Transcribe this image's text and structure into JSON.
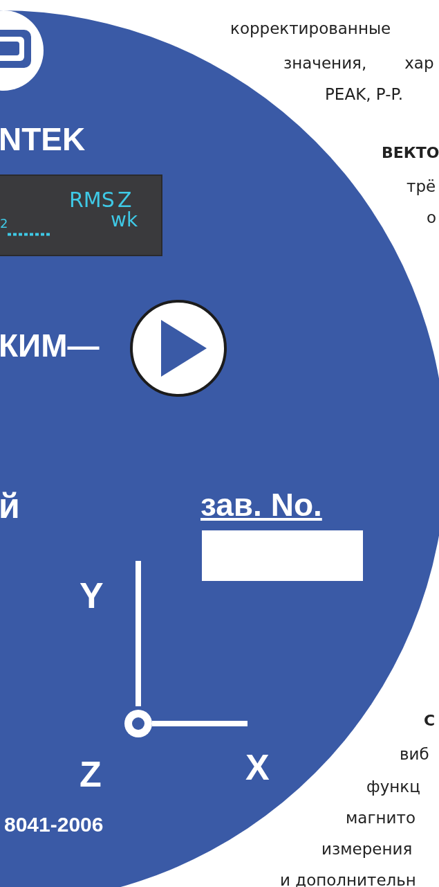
{
  "device_face": {
    "brand": "NTEK",
    "display": {
      "sub_digit": "2",
      "mode": "RMS",
      "axis": "Z",
      "weighting": "wk"
    },
    "mode_label": "КИМ—",
    "left_fragment": "й",
    "serial_label": "зав. No.",
    "axes": {
      "y": "Y",
      "z": "Z",
      "x": "X"
    },
    "standard": "8041-2006"
  },
  "text_lines": [
    {
      "kind": "plain",
      "parts": [
        "корректированные"
      ]
    },
    {
      "kind": "plain",
      "parts": [
        "значения,",
        "хар"
      ]
    },
    {
      "kind": "plain",
      "parts": [
        "PEAK, P-P."
      ]
    },
    {
      "kind": "bold",
      "parts": [
        "ВЕКТО"
      ]
    },
    {
      "kind": "plain",
      "parts": [
        "трё"
      ]
    },
    {
      "kind": "plain",
      "parts": [
        "о"
      ]
    },
    {
      "kind": "bold",
      "parts": [
        "С"
      ]
    },
    {
      "kind": "plain",
      "parts": [
        "виб"
      ]
    },
    {
      "kind": "plain",
      "parts": [
        "функц"
      ]
    },
    {
      "kind": "plain",
      "parts": [
        "магнито"
      ]
    },
    {
      "kind": "plain",
      "parts": [
        "измерения"
      ]
    },
    {
      "kind": "plain",
      "parts": [
        "и дополнительн"
      ]
    }
  ]
}
